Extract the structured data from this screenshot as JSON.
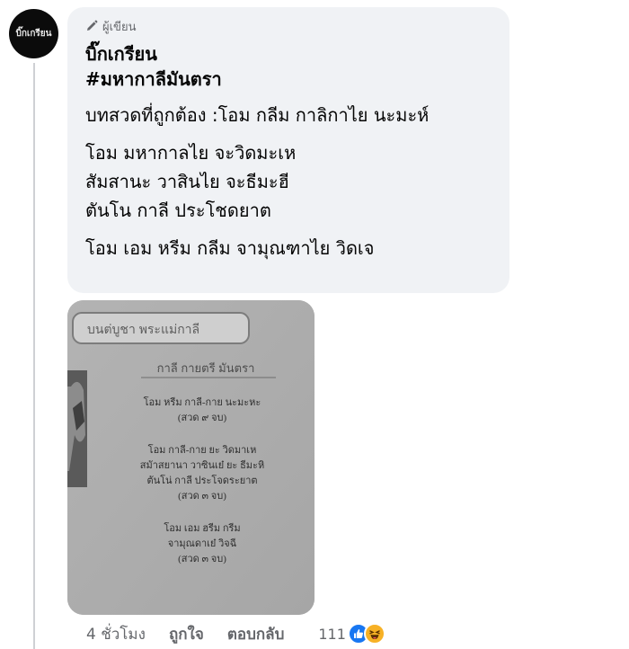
{
  "comment": {
    "author": {
      "name": "บิ๊กเกรียน",
      "badge": "ผู้เขียน",
      "avatar_text": "บิ๊กเกรียน"
    },
    "hashtag": "#มหากาลีมันตรา",
    "paragraphs": [
      "บทสวดที่ถูกต้อง :โอม กลีม กาลิกาไย นะมะห์",
      "โอม มหากาลไย จะวิดมะเห",
      "สัมสานะ วาสินไย จะธีมะฮี",
      "ตันโน กาลี ประโชดยาต",
      "โอม เอม หรีม กลีม จามุณฑาไย วิดเจ"
    ],
    "image": {
      "header_label": "บนต่บูชา พระแม่กาลี",
      "title": "กาลี กายตรี มันตรา",
      "verse1": [
        "โอม หรีม กาลี-กาย นะมะหะ",
        "(สวด ๙ จบ)"
      ],
      "verse2": [
        "โอม กาลี-กาย ยะ วิดมาเห",
        "สมัาสยานา วาซินเย๋ ยะ ธีมะหิ",
        "ตันโน่ กาลี ประโจดระยาต",
        "(สวด ๓ จบ)"
      ],
      "verse3": [
        "โอม เอม ฮรีม กรีม",
        "จามุณดาเย๋ วิจฉี",
        "(สวด ๓ จบ)"
      ]
    }
  },
  "actions": {
    "time": "4 ชั่วโมง",
    "like": "ถูกใจ",
    "reply": "ตอบกลับ",
    "reaction_count": "111"
  },
  "colors": {
    "bubble_bg": "#f0f2f5",
    "meta_text": "#65676b",
    "like_blue": "#1877f2",
    "haha_yellow": "#f7b125"
  }
}
